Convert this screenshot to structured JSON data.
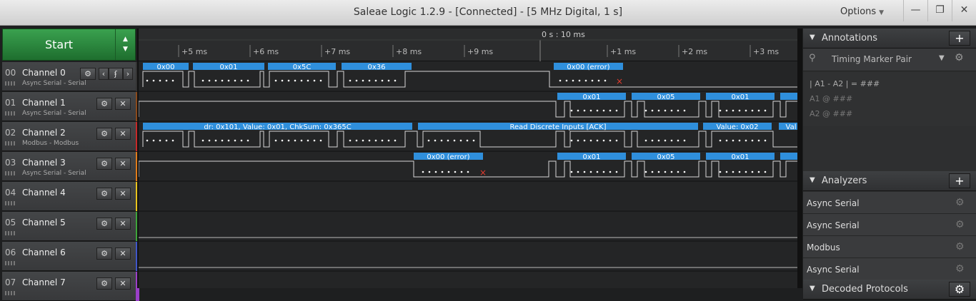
{
  "window": {
    "title": "Saleae Logic 1.2.9 - [Connected] - [5 MHz Digital, 1 s]",
    "options": "Options",
    "minimize": "—",
    "maximize": "❐",
    "close": "✕"
  },
  "start": {
    "label": "Start",
    "arrow_up": "▲",
    "arrow_down": "▼"
  },
  "ruler": {
    "center": "0 s : 10 ms",
    "ticks": [
      "+5 ms",
      "+6 ms",
      "+7 ms",
      "+8 ms",
      "+9 ms",
      "+1 ms",
      "+2 ms",
      "+3 ms"
    ]
  },
  "channels": [
    {
      "num": "00",
      "name": "Channel 0",
      "sub": "Async Serial - Serial",
      "color": "#333333"
    },
    {
      "num": "01",
      "name": "Channel 1",
      "sub": "Async Serial - Serial",
      "color": "#8a4a1c"
    },
    {
      "num": "02",
      "name": "Channel 2",
      "sub": "Modbus - Modbus",
      "color": "#c62828"
    },
    {
      "num": "03",
      "name": "Channel 3",
      "sub": "Async Serial - Serial",
      "color": "#e07b1a"
    },
    {
      "num": "04",
      "name": "Channel 4",
      "sub": "",
      "color": "#e8c31c"
    },
    {
      "num": "05",
      "name": "Channel 5",
      "sub": "",
      "color": "#3ea53a"
    },
    {
      "num": "06",
      "name": "Channel 6",
      "sub": "",
      "color": "#3f56c9"
    },
    {
      "num": "07",
      "name": "Channel 7",
      "sub": "",
      "color": "#9b3fc9"
    }
  ],
  "channel_buttons": {
    "settings": "⚙",
    "close": "✕",
    "nav_left": "‹",
    "trigger": "ʄ",
    "nav_right": "›"
  },
  "decodes": {
    "ch0": [
      "0x00",
      "0x01",
      "0x5C",
      "0x36",
      "0x00 (error)"
    ],
    "ch1": [
      "0x01",
      "0x05",
      "0x01",
      ""
    ],
    "ch2": [
      "dr: 0x101, Value: 0x01, ChkSum: 0x365C",
      "Read Discrete Inputs [ACK]",
      "Value: 0x02",
      "Val"
    ],
    "ch3": [
      "0x00 (error)",
      "0x01",
      "0x05",
      "0x01",
      ""
    ]
  },
  "annotations": {
    "title": "Annotations",
    "add": "+",
    "marker": "Timing Marker Pair",
    "line1": "| A1 - A2 | = ###",
    "line2": "A1 @ ###",
    "line3": "A2 @ ###"
  },
  "analyzers": {
    "title": "Analyzers",
    "add": "+",
    "items": [
      "Async Serial",
      "Async Serial",
      "Modbus",
      "Async Serial"
    ]
  },
  "decoded": {
    "title": "Decoded Protocols"
  },
  "colors": {
    "decode_bar": "#2f8fdc",
    "signal": "#d8d8d8",
    "error": "#e23b2e",
    "start_green": "#2e8b3f"
  }
}
